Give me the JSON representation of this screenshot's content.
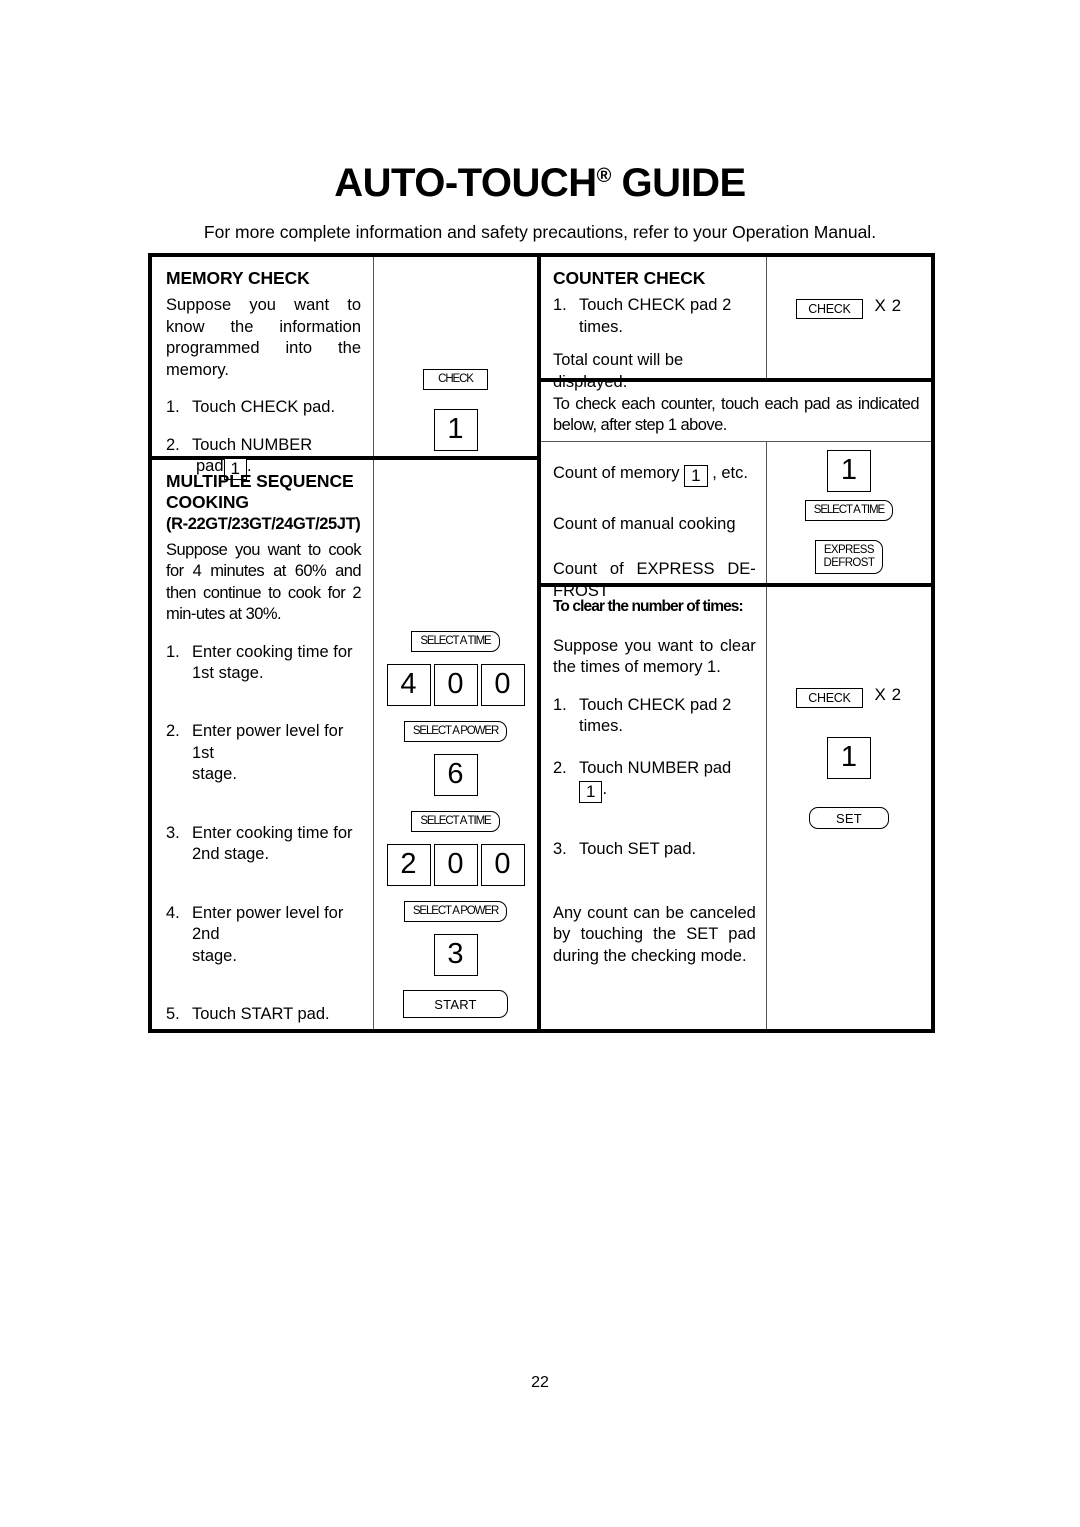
{
  "header": {
    "title_main": "AUTO-TOUCH",
    "title_reg": "®",
    "title_tail": " GUIDE",
    "subtitle": "For more complete information and safety precautions, refer to your Operation Manual."
  },
  "memory_check": {
    "heading": "MEMORY CHECK",
    "intro": "Suppose you want to know the information programmed into the memory.",
    "steps": [
      {
        "num": "1.",
        "text": "Touch CHECK pad."
      },
      {
        "num": "2.",
        "text_before": "Touch NUMBER",
        "text_line2_before": "pad ",
        "inline_key": "1",
        "text_line2_after": "."
      }
    ],
    "pads": {
      "check_label": "CHECK",
      "number_display": "1"
    }
  },
  "multiple_sequence": {
    "heading_line1": "MULTIPLE SEQUENCE",
    "heading_line2": "COOKING",
    "models": "(R-22GT/23GT/24GT/25JT)",
    "intro": "Suppose you want to cook for 4 minutes at 60% and then continue to cook for 2 min-utes at 30%.",
    "steps": [
      {
        "num": "1.",
        "line1": "Enter cooking time for",
        "line2": "1st stage."
      },
      {
        "num": "2.",
        "line1": "Enter power level for 1st",
        "line2": "stage."
      },
      {
        "num": "3.",
        "line1": "Enter cooking time for",
        "line2": "2nd stage."
      },
      {
        "num": "4.",
        "line1": "Enter power level for 2nd",
        "line2": "stage."
      },
      {
        "num": "5.",
        "line1": "Touch START pad.",
        "line2": ""
      }
    ],
    "pads": {
      "select_time_label": "SELECT A TIME",
      "select_power_label": "SELECT A POWER",
      "start_label": "START",
      "stage1_time": [
        "4",
        "0",
        "0"
      ],
      "stage1_power": "6",
      "stage2_time": [
        "2",
        "0",
        "0"
      ],
      "stage2_power": "3"
    }
  },
  "counter_check": {
    "heading": "COUNTER CHECK",
    "steps": [
      {
        "num": "1.",
        "line1": "Touch CHECK pad 2",
        "line2": "times."
      }
    ],
    "total_note": "Total count will be displayed.",
    "pads": {
      "check_label": "CHECK",
      "check_multiplier": "X 2"
    },
    "instruction_row": "To check each counter, touch each pad as indicated below, after step 1 above.",
    "counts": [
      {
        "label_before": "Count of memory ",
        "inline_key": "1",
        "label_after": " , etc.",
        "pad_type": "digit",
        "pad_label": "1"
      },
      {
        "label_before": "Count of manual cooking",
        "inline_key": "",
        "label_after": "",
        "pad_type": "pad",
        "pad_label": "SELECT A TIME"
      },
      {
        "label_before": "Count of EXPRESS DE-FROST",
        "inline_key": "",
        "label_after": "",
        "pad_type": "pad2",
        "pad_label_line1": "EXPRESS",
        "pad_label_line2": "DEFROST"
      }
    ],
    "clear": {
      "heading": "To clear the number of times:",
      "intro": "Suppose you want to clear the times of memory 1.",
      "steps": [
        {
          "num": "1.",
          "line1": "Touch CHECK pad 2",
          "line2": "times."
        },
        {
          "num": "2.",
          "line1_before": "Touch NUMBER pad ",
          "inline_key": "1",
          "line1_after": "."
        },
        {
          "num": "3.",
          "line1": "Touch SET pad.",
          "line2": ""
        }
      ],
      "note": "Any count can be canceled by  touching the SET pad during the checking mode.",
      "pads": {
        "check_label": "CHECK",
        "check_multiplier": "X 2",
        "number_display": "1",
        "set_label": "SET"
      }
    }
  },
  "footer": {
    "page_number": "22"
  }
}
